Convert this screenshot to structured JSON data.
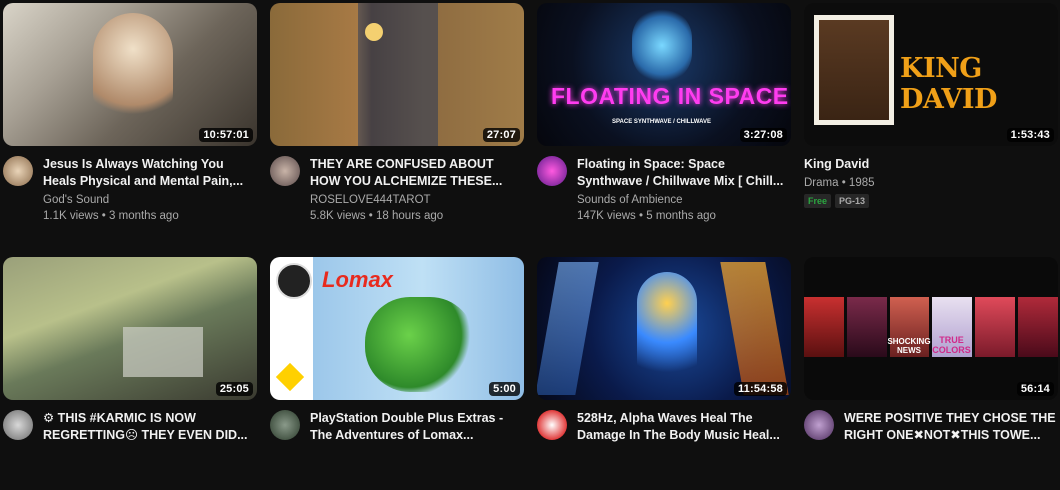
{
  "videos": [
    {
      "title": "Jesus Is Always Watching You Heals Physical and Mental Pain,...",
      "channel": "God's Sound",
      "stats": "1.1K views • 3 months ago",
      "duration": "10:57:01"
    },
    {
      "title": "THEY ARE CONFUSED ABOUT HOW YOU ALCHEMIZE THESE...",
      "channel": "ROSELOVE444TAROT",
      "stats": "5.8K views • 18 hours ago",
      "duration": "27:07"
    },
    {
      "title": "Floating in Space: Space Synthwave / Chillwave Mix [ Chill...",
      "channel": "Sounds of Ambience",
      "stats": "147K views • 5 months ago",
      "duration": "3:27:08",
      "thumb_text": "FLOATING IN SPACE",
      "thumb_subtext": "SPACE SYNTHWAVE / CHILLWAVE"
    },
    {
      "title": "King David",
      "channel": "Drama • 1985",
      "badges": [
        "Free",
        "PG-13"
      ],
      "duration": "1:53:43",
      "thumb_text": "KING DAVID"
    },
    {
      "title": "⚙ THIS #KARMIC IS NOW REGRETTING☹ THEY EVEN DID...",
      "duration": "25:05"
    },
    {
      "title": "PlayStation Double Plus Extras - The Adventures of Lomax...",
      "duration": "5:00",
      "thumb_text": "Lomax"
    },
    {
      "title": "528Hz, Alpha Waves Heal The Damage In The Body Music Heal...",
      "duration": "11:54:58"
    },
    {
      "title": "WERE POSITIVE THEY CHOSE THE RIGHT ONE✖NOT✖THIS TOWE...",
      "duration": "56:14",
      "thumb_text_1": "SHOCKING NEWS",
      "thumb_text_2": "TRUE COLORS"
    }
  ]
}
